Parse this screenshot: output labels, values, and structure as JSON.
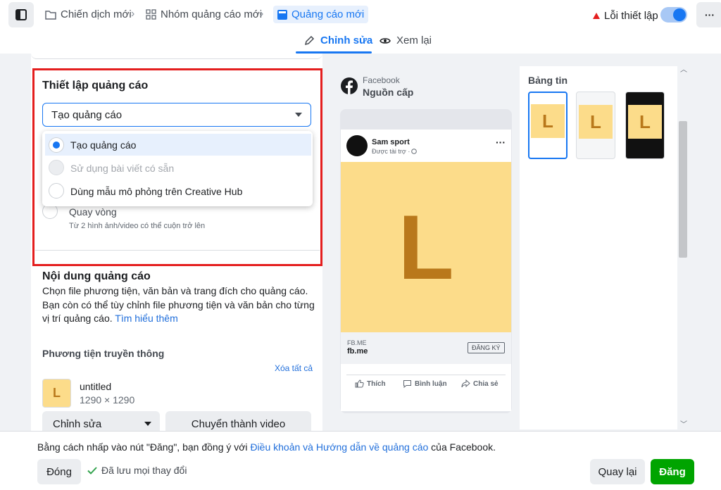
{
  "breadcrumb": {
    "campaign": "Chiến dịch mới",
    "adset": "Nhóm quảng cáo mới",
    "ad": "Quảng cáo mới"
  },
  "header": {
    "error_label": "Lỗi thiết lập",
    "more": "···"
  },
  "tabs": {
    "edit": "Chỉnh sửa",
    "review": "Xem lại"
  },
  "setup": {
    "title": "Thiết lập quảng cáo",
    "select_value": "Tạo quảng cáo",
    "options": [
      "Tạo quảng cáo",
      "Sử dụng bài viết có sẵn",
      "Dùng mẫu mô phỏng trên Creative Hub"
    ],
    "carousel_label": "Quay vòng",
    "carousel_desc": "Từ 2 hình ảnh/video có thể cuộn trở lên"
  },
  "content": {
    "title": "Nội dung quảng cáo",
    "desc": "Chọn file phương tiện, văn bản và trang đích cho quảng cáo. Bạn còn có thể tùy chỉnh file phương tiện và văn bản cho từng vị trí quảng cáo.",
    "learn_more": "Tìm hiểu thêm",
    "media_title": "Phương tiện truyền thông",
    "clear_all": "Xóa tất cả",
    "file_name": "untitled",
    "file_dims": "1290 × 1290",
    "thumb_letter": "L",
    "edit_btn": "Chỉnh sửa",
    "to_video_btn": "Chuyển thành video"
  },
  "preview": {
    "platform": "Facebook",
    "placement": "Nguồn cấp",
    "page_name": "Sam sport",
    "sponsored": "Được tài trợ · ",
    "image_letter": "L",
    "domain_small": "FB.ME",
    "domain": "fb.me",
    "cta": "ĐĂNG KÝ",
    "like": "Thích",
    "comment": "Bình luận",
    "share": "Chia sẻ",
    "feed_title": "Bảng tin",
    "mini_letter": "L"
  },
  "footer": {
    "terms_prefix": "Bằng cách nhấp vào nút \"Đăng\", bạn đồng ý với ",
    "terms_link": "Điều khoản và Hướng dẫn về quảng cáo",
    "terms_suffix": " của Facebook.",
    "close": "Đóng",
    "saved": "Đã lưu mọi thay đổi",
    "back": "Quay lại",
    "publish": "Đăng"
  },
  "colors": {
    "accent": "#1877f2",
    "publish": "#00a400",
    "highlight": "#e41e1e",
    "ad_bg": "#fcdc8a",
    "ad_letter": "#b9781b"
  }
}
